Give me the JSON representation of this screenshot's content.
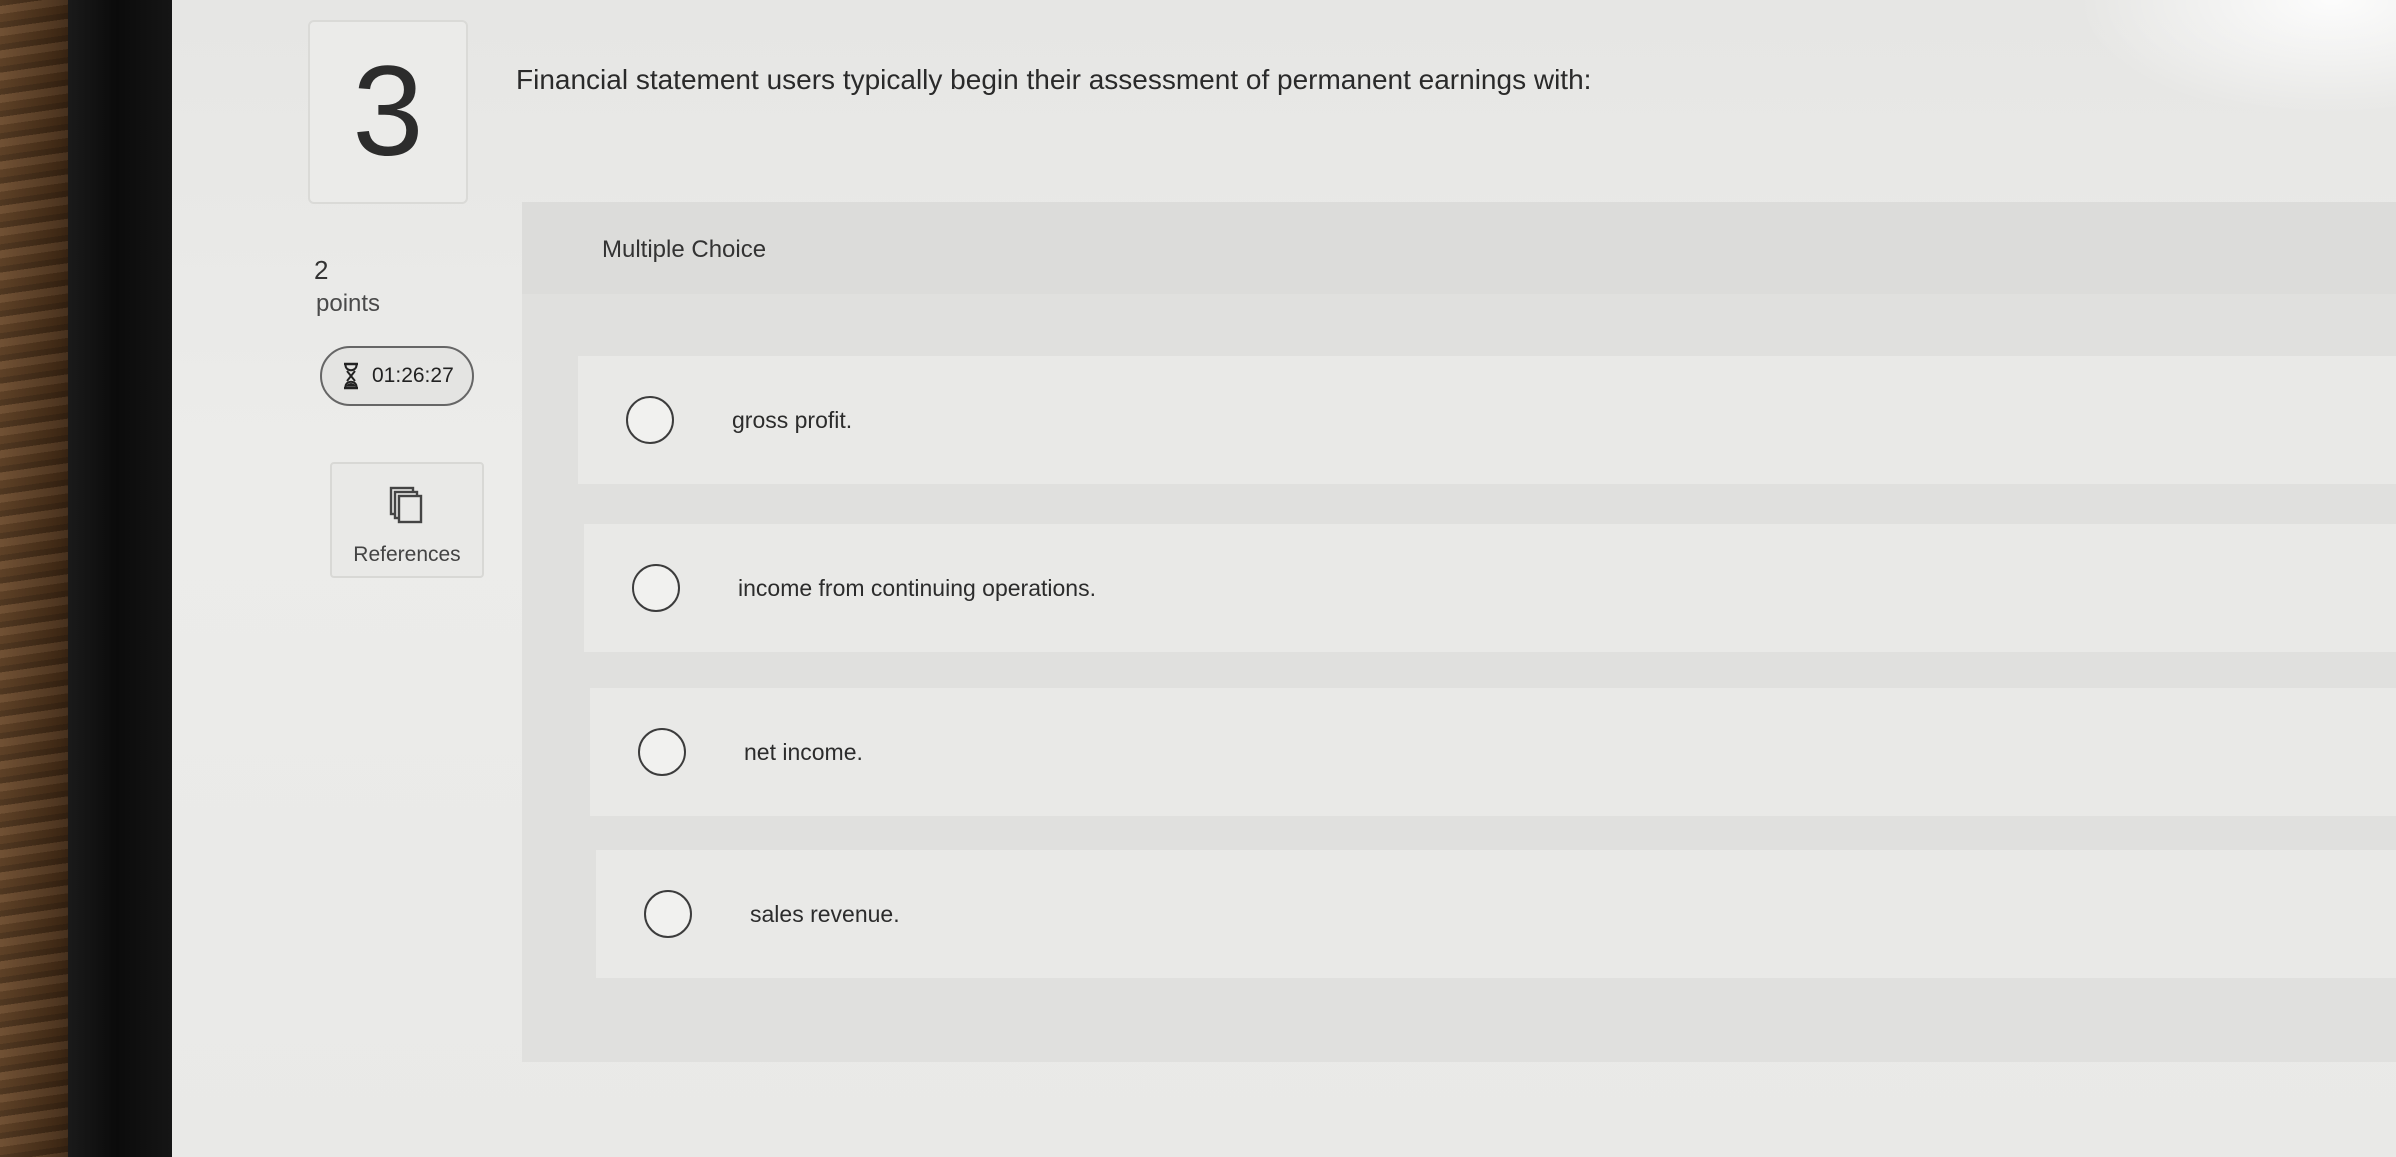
{
  "question": {
    "number": "3",
    "text": "Financial statement users typically begin their assessment of permanent earnings with:",
    "points_value": "2",
    "points_label": "points"
  },
  "timer": {
    "icon": "hourglass-icon",
    "value": "01:26:27"
  },
  "references": {
    "icon": "references-icon",
    "label": "References"
  },
  "multiple_choice": {
    "label": "Multiple Choice",
    "options": [
      {
        "text": "gross profit."
      },
      {
        "text": "income from continuing operations."
      },
      {
        "text": "net income."
      },
      {
        "text": "sales revenue."
      }
    ]
  }
}
